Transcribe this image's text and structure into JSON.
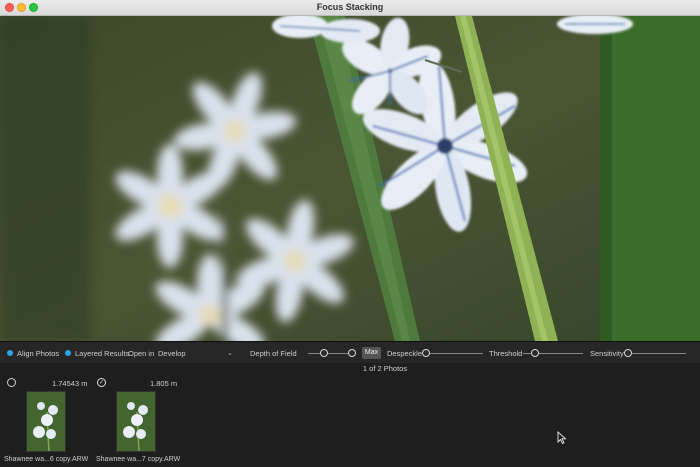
{
  "window": {
    "title": "Focus Stacking"
  },
  "controls": {
    "align_photos": "Align Photos",
    "layered_results": "Layered Results",
    "open_in_label": "Open in",
    "open_in_value": "Develop",
    "depth_of_field_label": "Depth of Field",
    "depth_of_field_level": 0.37,
    "max_label": "Max",
    "despeckle_label": "Despeckle",
    "despeckle_level": 0.05,
    "threshold_label": "Threshold",
    "threshold_level": 0.2,
    "sensitivity_label": "Sensitivity",
    "sensitivity_level": 0.0,
    "accent_color": "#2aa3e8"
  },
  "status": {
    "photo_count": "1 of 2 Photos"
  },
  "thumbnails": [
    {
      "distance": "1.74543 m",
      "filename": "Shawnee wa...6 copy.ARW",
      "checked": false
    },
    {
      "distance": "1.805 m",
      "filename": "Shawnee wa...7 copy.ARW",
      "checked": true
    }
  ]
}
